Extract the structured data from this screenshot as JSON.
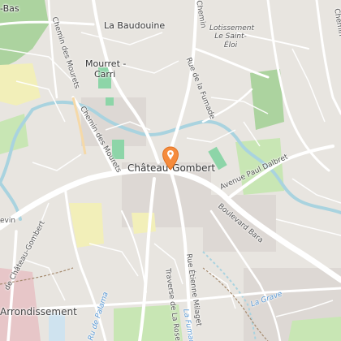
{
  "map": {
    "colors": {
      "background": "#e8e5e0",
      "road": "#ffffff",
      "river": "#a9d3df",
      "park": "#c8e6b4",
      "forest": "#acd39f",
      "sports": "#8dd5a8",
      "industrial": "#f2efb9",
      "residential": "#d9d2d0",
      "marker": "#f58b3c"
    },
    "labels": {
      "chateau_gombert": "Château-Gombert",
      "la_baudouine": "La Baudouine",
      "mourret_line1": "Mourret -",
      "mourret_line2": "Carri",
      "lotissement_line1": "Lotissement",
      "lotissement_line2": "Le Saint-",
      "lotissement_line3": "Éloi",
      "bas": "-Bas",
      "arrondissement": "Arrondissement",
      "levin": "evin"
    },
    "roads": {
      "chemin_des_mourets_upper": "Chemin des Mourets",
      "chemin_des_mourets_lower": "Chemin des Mourets",
      "rue_fumade": "Rue de la Fumade",
      "avenue_dalbret": "Avenue Paul Dalbret",
      "boulevard_bara": "Boulevard Bara",
      "chateau_gombert_road": "de Château-Gombert",
      "traverse_rose": "Traverse de La Rose",
      "rue_etienne_milaget": "Rue Étienne Milaget",
      "chemin_top": "Chemin",
      "chemin_right": "Chemin"
    },
    "water": {
      "la_grave": "La Grave",
      "la_fumade": "La Fumade",
      "ru_de_palama": "Ru de Palama"
    },
    "marker_icon": "map-pin-icon"
  }
}
